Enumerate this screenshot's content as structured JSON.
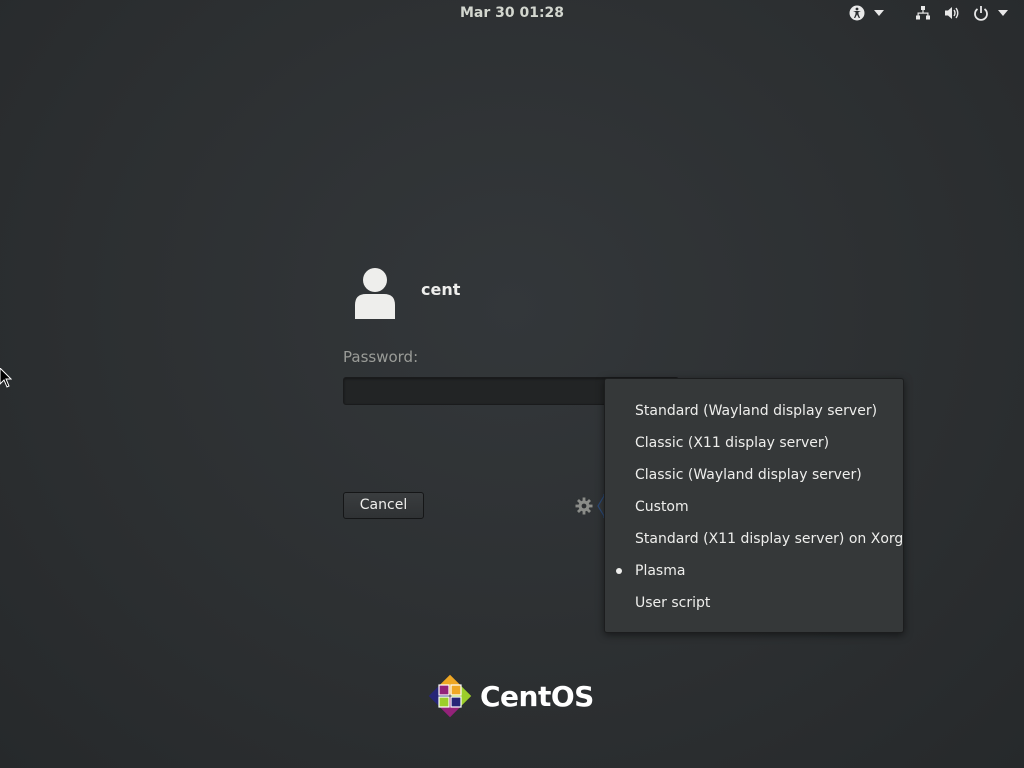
{
  "topbar": {
    "clock": "Mar 30  01:28",
    "icons": [
      "accessibility-icon",
      "chevron-down-icon",
      "network-wired-icon",
      "volume-icon",
      "power-icon",
      "chevron-down-icon"
    ]
  },
  "login": {
    "username": "cent",
    "password_label": "Password:",
    "password_value": "",
    "cancel_label": "Cancel",
    "settings_icon": "gear-icon"
  },
  "session_menu": {
    "items": [
      {
        "label": "Standard (Wayland display server)",
        "selected": false
      },
      {
        "label": "Classic (X11 display server)",
        "selected": false
      },
      {
        "label": "Classic (Wayland display server)",
        "selected": false
      },
      {
        "label": "Custom",
        "selected": false
      },
      {
        "label": "Standard (X11 display server) on Xorg",
        "selected": false
      },
      {
        "label": "Plasma",
        "selected": true
      },
      {
        "label": "User script",
        "selected": false
      }
    ]
  },
  "branding": {
    "logo_text": "CentOS"
  },
  "colors": {
    "background": "#2b2e30",
    "menu_background": "#353839",
    "text": "#eeeeec",
    "muted_text": "#9a9c98"
  }
}
